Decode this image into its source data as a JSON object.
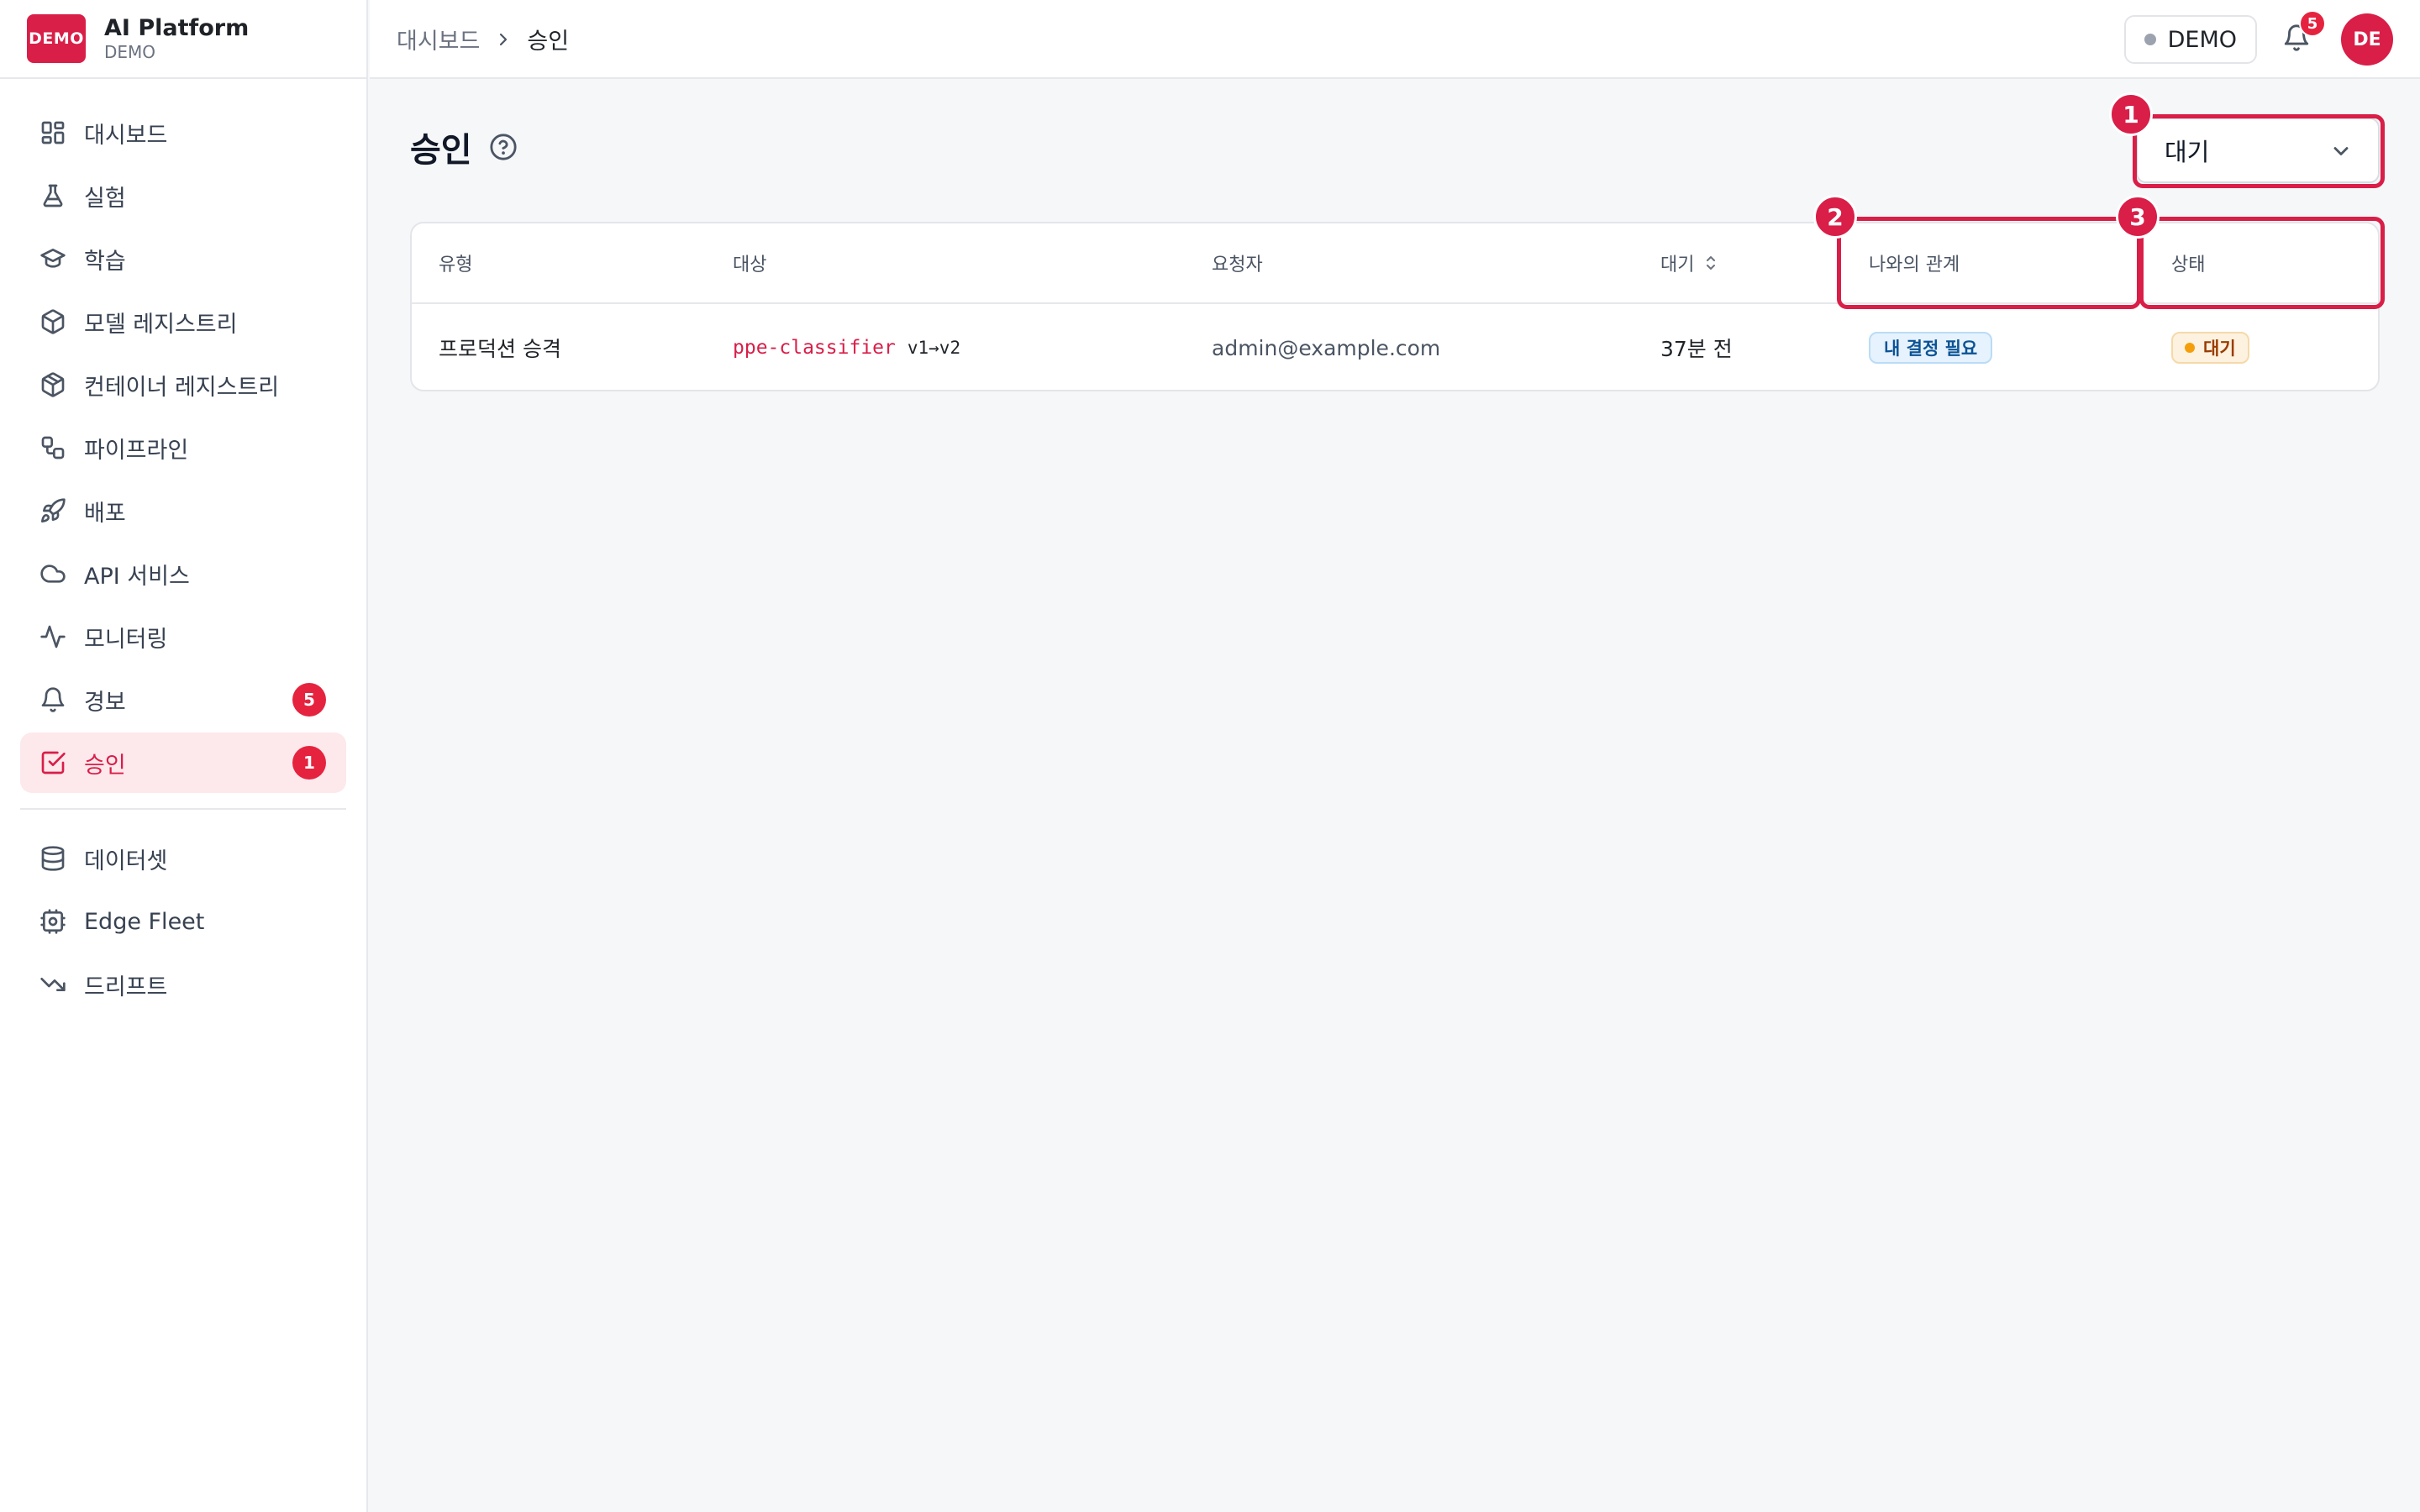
{
  "brand": {
    "logo_text": "DEMO",
    "title": "AI Platform",
    "subtitle": "DEMO"
  },
  "sidebar": {
    "items": [
      {
        "label": "대시보드",
        "icon": "dashboard-icon"
      },
      {
        "label": "실험",
        "icon": "flask-icon"
      },
      {
        "label": "학습",
        "icon": "graduation-cap-icon"
      },
      {
        "label": "모델 레지스트리",
        "icon": "cube-icon"
      },
      {
        "label": "컨테이너 레지스트리",
        "icon": "package-icon"
      },
      {
        "label": "파이프라인",
        "icon": "workflow-icon"
      },
      {
        "label": "배포",
        "icon": "rocket-icon"
      },
      {
        "label": "API 서비스",
        "icon": "cloud-icon"
      },
      {
        "label": "모니터링",
        "icon": "activity-icon"
      },
      {
        "label": "경보",
        "icon": "bell-icon",
        "badge": "5"
      },
      {
        "label": "승인",
        "icon": "check-square-icon",
        "badge": "1",
        "active": true
      }
    ],
    "secondary_items": [
      {
        "label": "데이터셋",
        "icon": "database-icon"
      },
      {
        "label": "Edge Fleet",
        "icon": "edge-device-icon"
      },
      {
        "label": "드리프트",
        "icon": "trending-down-icon"
      }
    ]
  },
  "topbar": {
    "breadcrumb": {
      "parent": "대시보드",
      "current": "승인"
    },
    "env_label": "DEMO",
    "notification_count": "5",
    "avatar_initials": "DE"
  },
  "page": {
    "title": "승인",
    "status_filter": {
      "selected": "대기"
    }
  },
  "table": {
    "headers": {
      "type": "유형",
      "target": "대상",
      "requester": "요청자",
      "waiting": "대기",
      "relation": "나와의 관계",
      "status": "상태"
    },
    "rows": [
      {
        "type": "프로덕션 승격",
        "target_name": "ppe-classifier",
        "target_version": "v1→v2",
        "requester": "admin@example.com",
        "waiting": "37분 전",
        "relation": "내 결정 필요",
        "status": "대기"
      }
    ]
  },
  "annotations": [
    "1",
    "2",
    "3"
  ],
  "colors": {
    "brand": "#d91e48",
    "badge_red": "#e5233f",
    "relation_badge_bg": "#e6f2fd",
    "status_badge_bg": "#fdf2df",
    "status_dot": "#f59e0b"
  }
}
